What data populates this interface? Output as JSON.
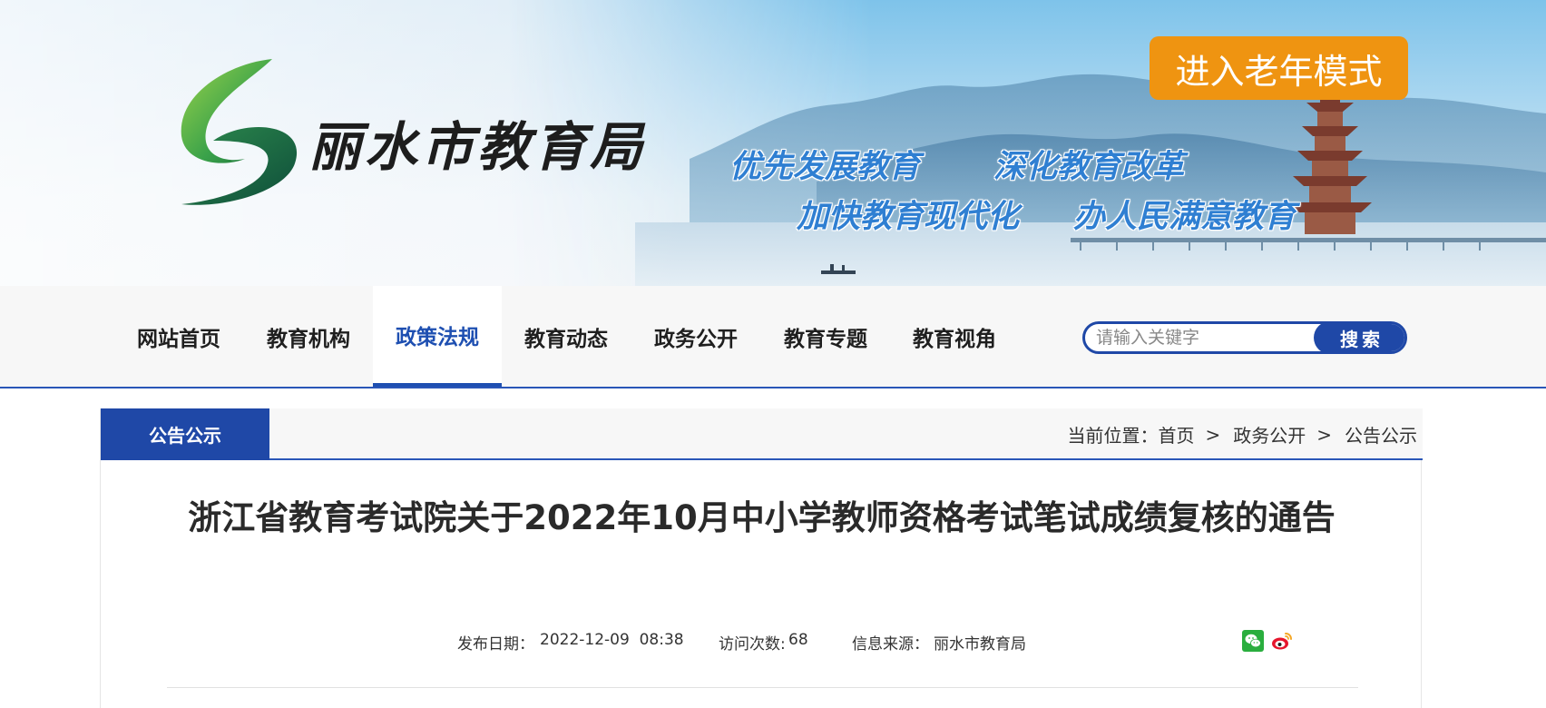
{
  "header": {
    "site_name": "丽水市教育局",
    "slogans": [
      "优先发展教育",
      "深化教育改革",
      "加快教育现代化",
      "办人民满意教育"
    ],
    "elder_mode_label": "进入老年模式",
    "accent_color": "#ef9411"
  },
  "nav": {
    "items": [
      {
        "label": "网站首页"
      },
      {
        "label": "教育机构"
      },
      {
        "label": "政策法规",
        "active": true
      },
      {
        "label": "教育动态"
      },
      {
        "label": "政务公开"
      },
      {
        "label": "教育专题"
      },
      {
        "label": "教育视角"
      }
    ],
    "brand_color": "#1e4fb1"
  },
  "search": {
    "placeholder": "请输入关键字",
    "value": "",
    "button_label": "搜索"
  },
  "section": {
    "tab_label": "公告公示"
  },
  "breadcrumb": {
    "prefix": "当前位置：",
    "items": [
      "首页",
      "政务公开",
      "公告公示"
    ],
    "separator": ">"
  },
  "article": {
    "title": "浙江省教育考试院关于2022年10月中小学教师资格考试笔试成绩复核的通告",
    "publish_label": "发布日期：",
    "publish_value": "2022-12-09  08:38",
    "visits_label": "访问次数:",
    "visits_value": "68",
    "source_label": "信息来源：",
    "source_value": "丽水市教育局"
  },
  "share": {
    "icons": [
      "wechat-icon",
      "weibo-icon"
    ]
  }
}
